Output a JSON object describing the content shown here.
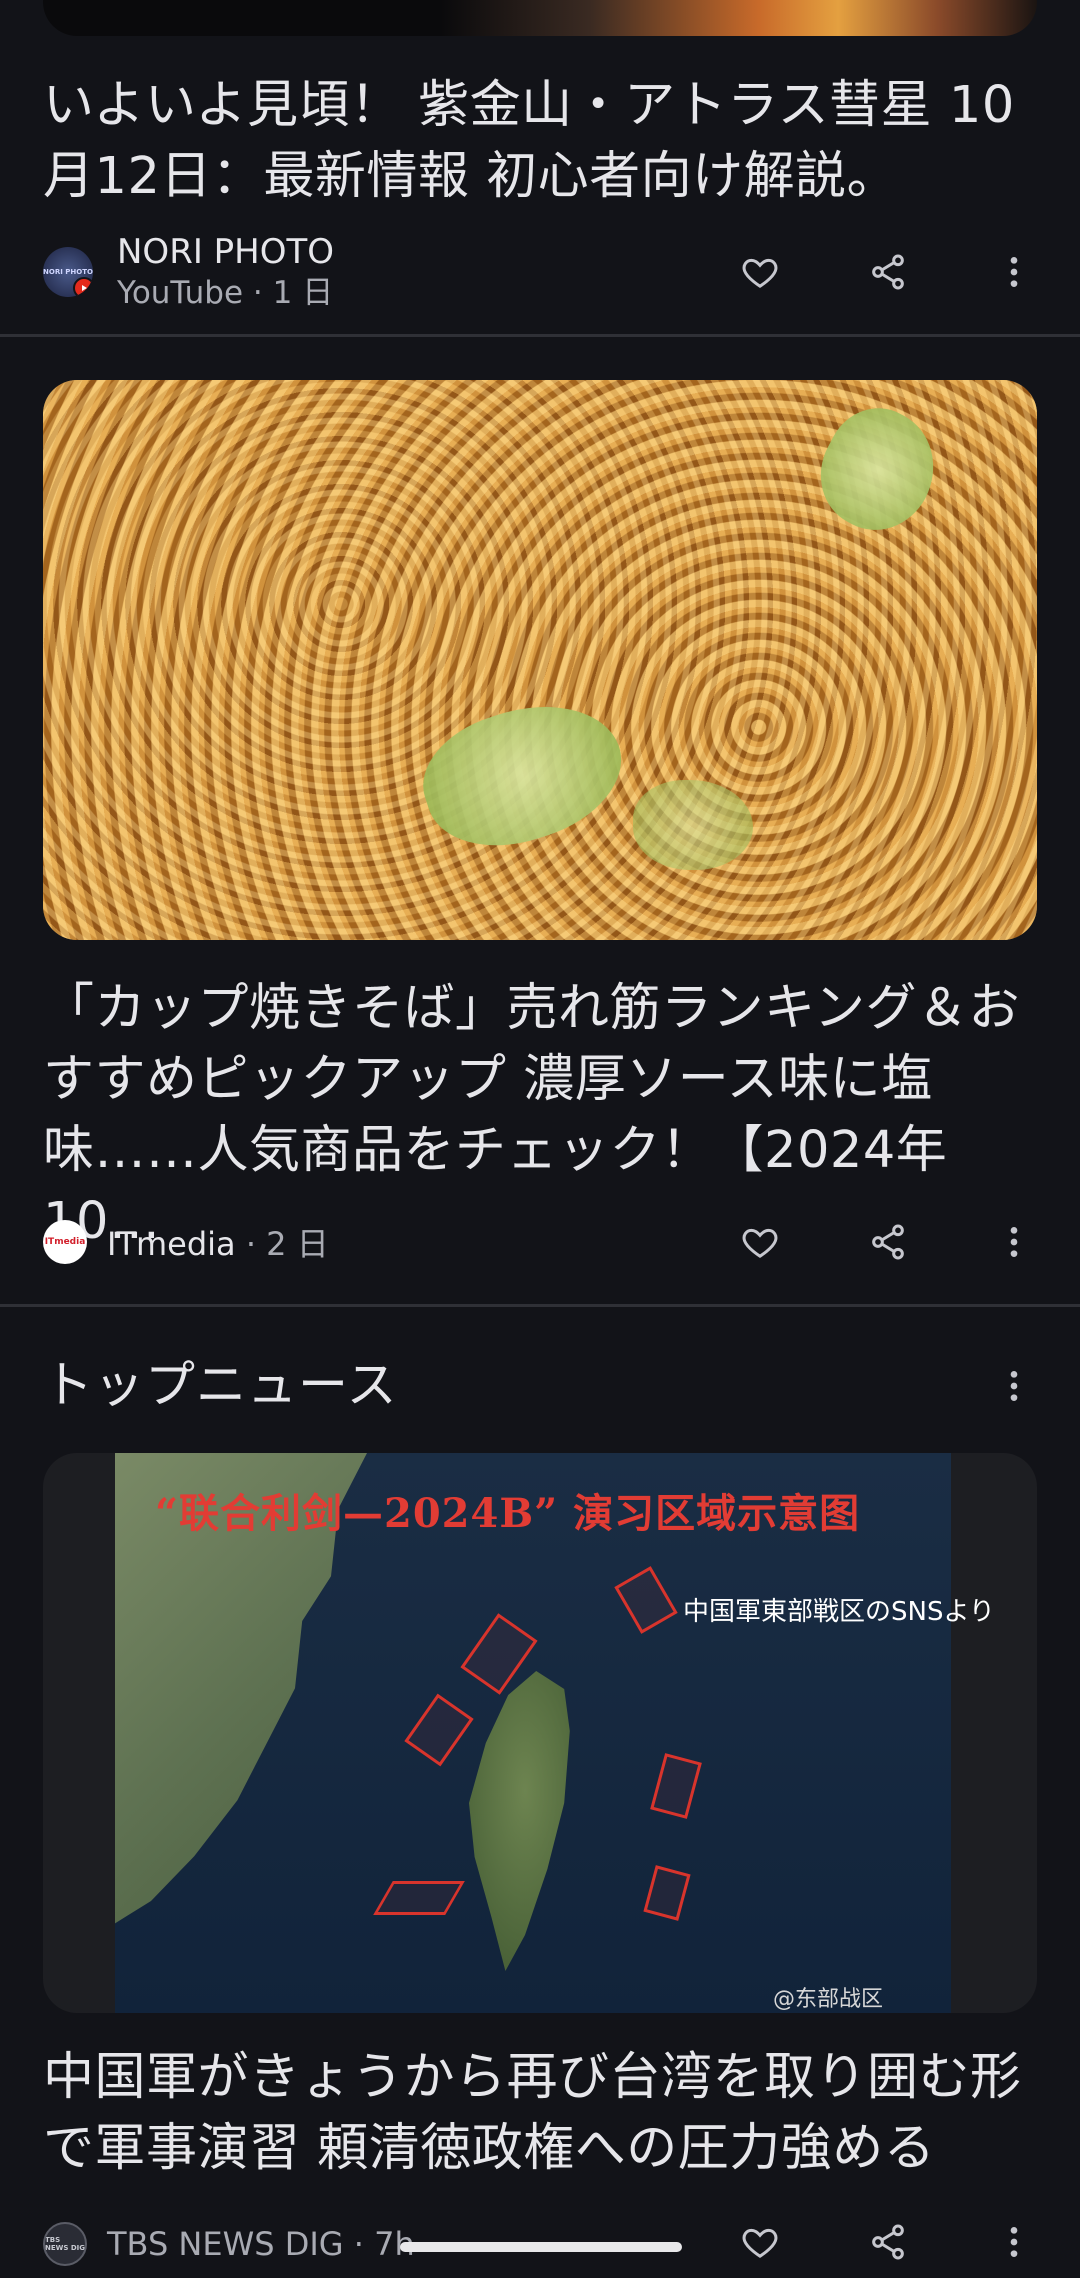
{
  "cards": [
    {
      "title": "いよいよ見頃！ 紫金山・アトラス彗星 10月12日：最新情報 初心者向け解説。",
      "source": "NORI PHOTO",
      "meta": "YouTube · 1 日",
      "logo_text": "NORI PHOTO"
    },
    {
      "title": "「カップ焼きそば」売れ筋ランキング＆おすすめピックアップ 濃厚ソース味に塩味……人気商品をチェック！【2024年10…",
      "source": "ITmedia",
      "meta": " · 2 日",
      "logo_text": "ITmedia"
    },
    {
      "title": "中国軍がきょうから再び台湾を取り囲む形で軍事演習 頼清徳政権への圧力強める",
      "source": "TBS NEWS DIG",
      "meta": " · 7h",
      "logo_text": "TBS NEWS DIG",
      "image_caption": "“联合利剑—2024B” 演习区域示意图",
      "image_source_note": "中国軍東部戦区のSNSより",
      "image_watermark": "@东部战区"
    }
  ],
  "section": {
    "title": "トップニュース"
  },
  "icons": {
    "like": "heart-outline-icon",
    "share": "share-icon",
    "more": "more-vert-icon"
  },
  "colors": {
    "background": "#121318",
    "divider": "#2f3036",
    "youtube_red": "#e32a1c"
  }
}
